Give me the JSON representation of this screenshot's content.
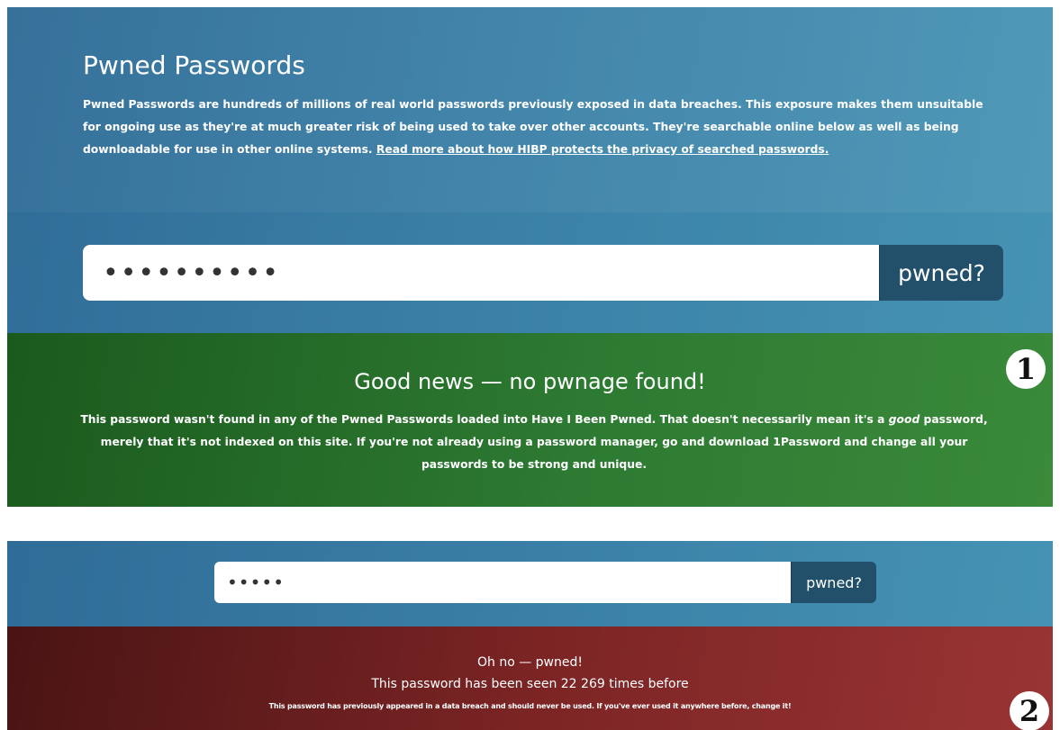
{
  "top": {
    "title": "Pwned Passwords",
    "intro_text": "Pwned Passwords are hundreds of millions of real world passwords previously exposed in data breaches. This exposure makes them unsuitable for ongoing use as they're at much greater risk of being used to take over other accounts. They're searchable online below as well as being downloadable for use in other online systems. ",
    "intro_link": "Read more about how HIBP protects the privacy of searched passwords.",
    "search": {
      "value": "••••••••••",
      "button_label": "pwned?"
    }
  },
  "good_result": {
    "badge": "❶",
    "heading": "Good news — no pwnage found!",
    "body_part1": "This password wasn't found in any of the Pwned Passwords loaded into Have I Been Pwned. That doesn't necessarily mean it's a ",
    "body_em": "good",
    "body_part2": " password, merely that it's not indexed on this site. If you're not already using a password manager, go and download 1Password and change all your passwords to be strong and unique."
  },
  "bottom": {
    "search": {
      "value": "•••••",
      "button_label": "pwned?"
    }
  },
  "bad_result": {
    "badge": "❷",
    "heading": "Oh no — pwned!",
    "count_text": "This password has been seen 22 269 times before",
    "body": "This password has previously appeared in a data breach and should never be used. If you've ever used it anywhere before, change it!"
  },
  "colors": {
    "panel_blue": "#3a7fa6",
    "button_dark": "#22506a",
    "good_green": "#2d7a32",
    "bad_red": "#7b2424"
  }
}
